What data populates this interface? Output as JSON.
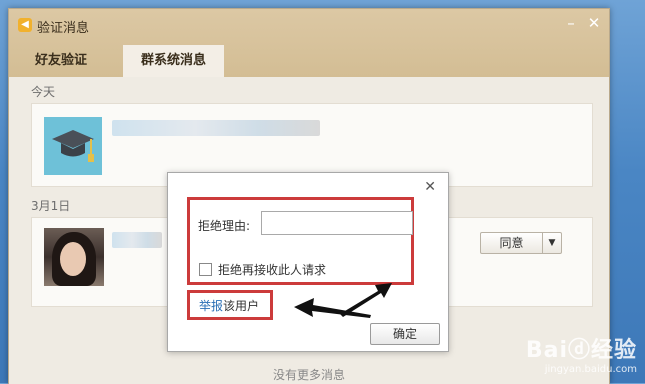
{
  "window": {
    "title": "验证消息",
    "app_icon": "speaker-icon"
  },
  "tabs": [
    {
      "label": "好友验证",
      "active": false
    },
    {
      "label": "群系统消息",
      "active": true
    }
  ],
  "sections": [
    {
      "date": "今天"
    },
    {
      "date": "3月1日",
      "action_label": "同意"
    }
  ],
  "footer": {
    "no_more": "没有更多消息"
  },
  "dialog": {
    "reason_label": "拒绝理由:",
    "reason_value": "",
    "reason_placeholder": "",
    "checkbox_label": "拒绝再接收此人请求",
    "checkbox_checked": false,
    "report_link": "举报",
    "report_suffix": "该用户",
    "ok_label": "确定"
  },
  "watermark": {
    "main": "Baiⓓ经验",
    "sub": "jingyan.baidu.com"
  },
  "colors": {
    "annotation_red": "#cc3b3b",
    "link_blue": "#2a6fb5",
    "title_tan": "#d3bd94"
  }
}
